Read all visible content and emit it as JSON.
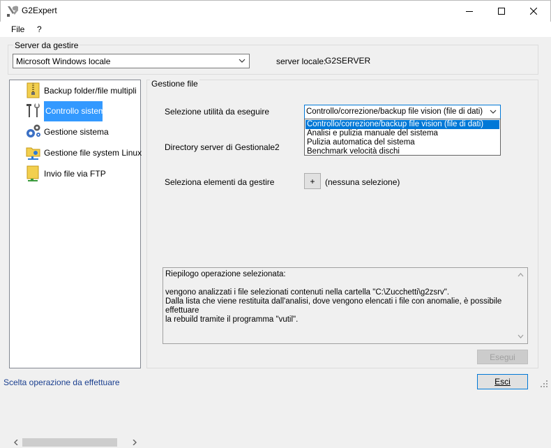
{
  "window": {
    "title": "G2Expert",
    "app_icon": "tools-icon",
    "controls": [
      "minimize-icon",
      "maximize-icon",
      "close-icon"
    ]
  },
  "menu": {
    "items": [
      {
        "label": "File"
      },
      {
        "label": "?"
      }
    ]
  },
  "server": {
    "group_label": "Server da gestire",
    "selected": "Microsoft Windows locale",
    "local_label": "server locale:",
    "local_value": "G2SERVER"
  },
  "tree": {
    "items": [
      {
        "label": "Backup folder/file multipli",
        "icon": "zip-folder-icon",
        "selected": false
      },
      {
        "label": "Controllo sistema",
        "icon": "tools-icon",
        "selected": true
      },
      {
        "label": "Gestione sistema",
        "icon": "gears-icon",
        "selected": false
      },
      {
        "label": "Gestione file system Linux",
        "icon": "network-folder-icon",
        "selected": false
      },
      {
        "label": "Invio file via FTP",
        "icon": "ftp-file-icon",
        "selected": false
      }
    ]
  },
  "file_panel": {
    "group_label": "Gestione file",
    "utility_label": "Selezione utilità da eseguire",
    "utility_selected": "Controllo/correzione/backup file vision (file di dati)",
    "utility_options": [
      "Controllo/correzione/backup file vision (file di dati)",
      "Analisi e pulizia manuale del sistema",
      "Pulizia automatica del sistema",
      "Benchmark velocità dischi"
    ],
    "directory_label": "Directory server di Gestionale2",
    "elements_label": "Seleziona elementi da gestire",
    "add_button": "+",
    "no_selection": "(nessuna selezione)",
    "summary": "Riepilogo operazione selezionata:\n\nvengono analizzati i file selezionati contenuti nella cartella \"C:\\Zucchetti\\g2zsrv\".\nDalla lista che viene restituita dall'analisi, dove vengono elencati i file con anomalie, è possibile effettuare\nla rebuild tramite il programma \"vutil\".",
    "run_button": "Esegui"
  },
  "status": {
    "text": "Scelta operazione da effettuare",
    "exit_button": "Esci"
  }
}
